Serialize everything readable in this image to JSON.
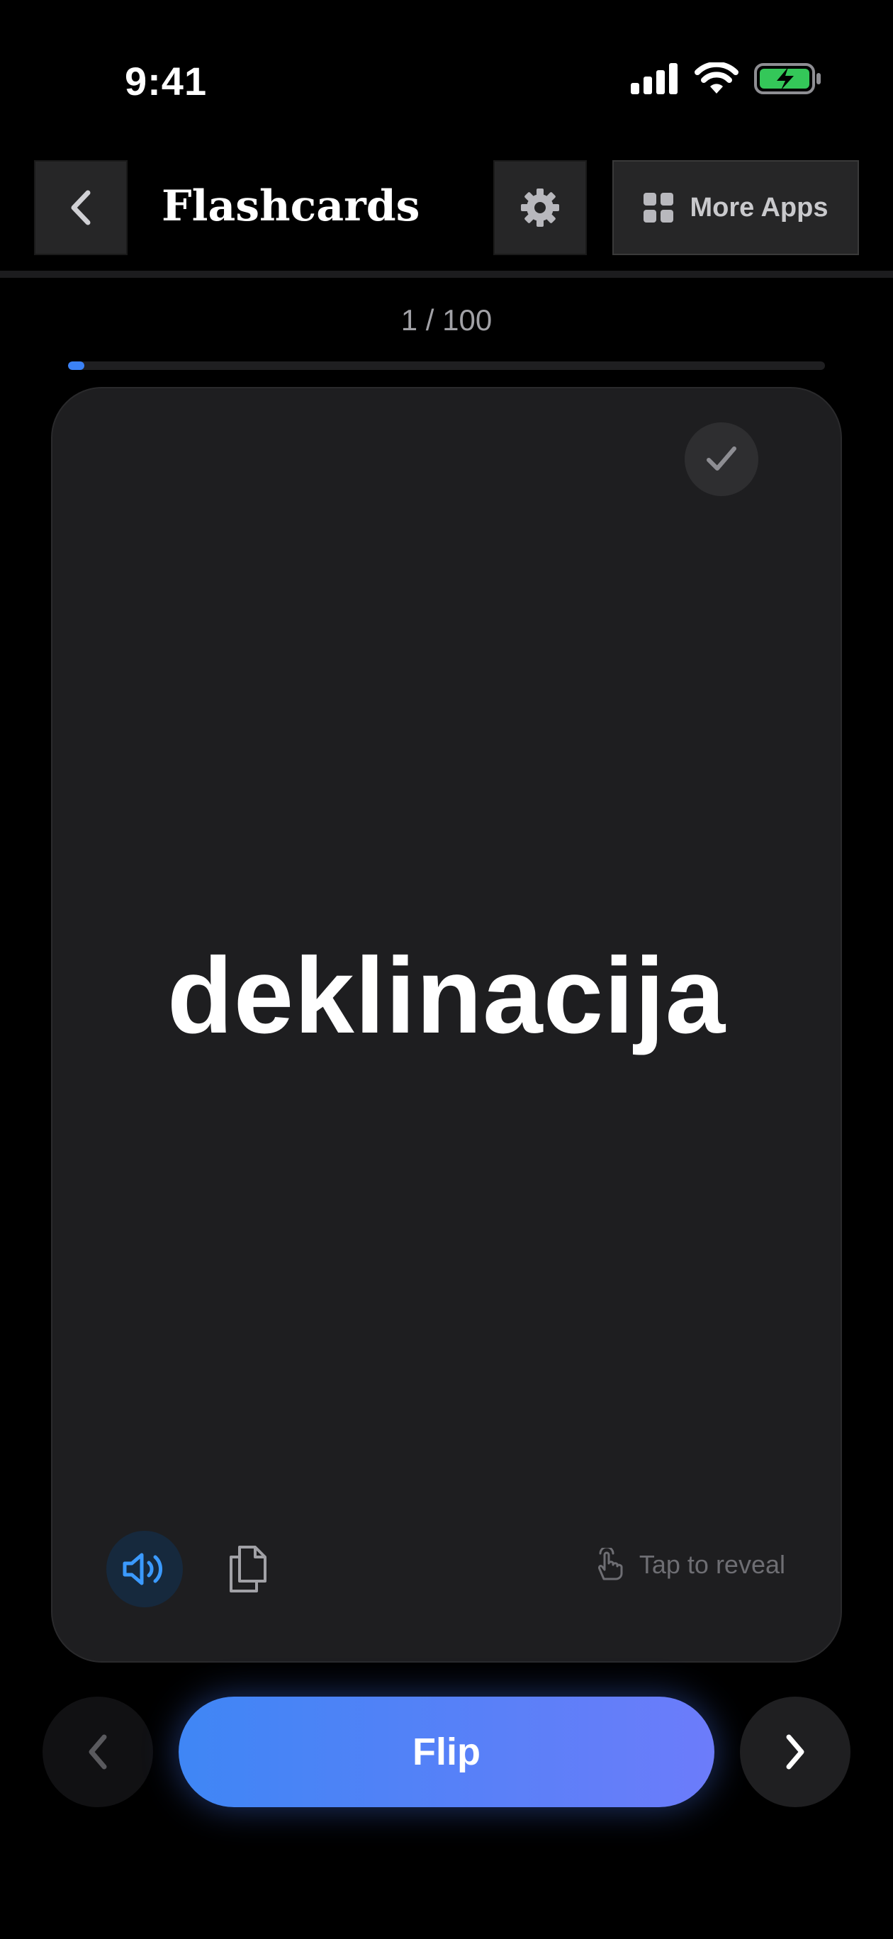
{
  "status_bar": {
    "time": "9:41",
    "icons": [
      "cellular-signal-icon",
      "wifi-icon",
      "battery-charging-icon"
    ],
    "battery_color": "#34c759"
  },
  "header": {
    "back_icon": "chevron-left-icon",
    "title": "Flashcards",
    "settings_icon": "gear-icon",
    "more_apps_icon": "grid-icon",
    "more_apps_label": "More Apps"
  },
  "progress": {
    "counter": "1 / 100",
    "current": 1,
    "total": 100,
    "accent": "#3b82f6"
  },
  "card": {
    "word": "deklinacija",
    "mark_known_icon": "checkmark-icon",
    "speaker_icon": "speaker-icon",
    "copy_icon": "copy-icon",
    "reveal_icon": "tap-hand-icon",
    "reveal_hint": "Tap to reveal"
  },
  "controls": {
    "prev_icon": "chevron-left-icon",
    "flip_label": "Flip",
    "next_icon": "chevron-right-icon",
    "gradient": [
      "#3f86f5",
      "#6c7cfa"
    ]
  }
}
